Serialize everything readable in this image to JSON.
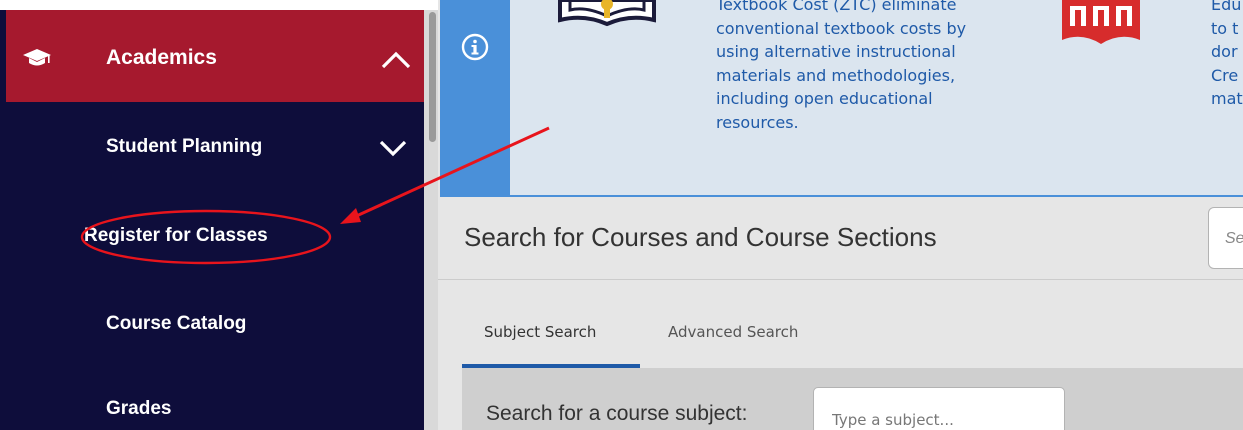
{
  "sidebar": {
    "section": {
      "label": "Academics",
      "icon": "graduation-cap-icon",
      "expanded": true,
      "background": "#a6192e"
    },
    "items": [
      {
        "label": "Student Planning",
        "has_submenu": true
      },
      {
        "label": "Register for Classes",
        "highlighted": true
      },
      {
        "label": "Course Catalog"
      },
      {
        "label": "Grades"
      }
    ],
    "background": "#0e0d3b"
  },
  "notice": {
    "lines": [
      "Textbook Cost (ZTC) eliminate",
      "conventional textbook costs by",
      "using alternative instructional",
      "materials and methodologies,",
      "including open educational",
      "resources."
    ],
    "partial_lines": [
      "Edu",
      "to t",
      "dor",
      "Cre",
      "mat"
    ],
    "accent": "#4a90d9",
    "text_color": "#1f5aa8"
  },
  "search": {
    "heading": "Search for Courses and Course Sections",
    "keyword_placeholder": "Se",
    "tabs": [
      {
        "label": "Subject Search",
        "active": true
      },
      {
        "label": "Advanced Search",
        "active": false
      }
    ],
    "subject_label": "Search for a course subject:",
    "subject_placeholder": "Type a subject..."
  },
  "annotation": {
    "color": "#e8141c"
  }
}
